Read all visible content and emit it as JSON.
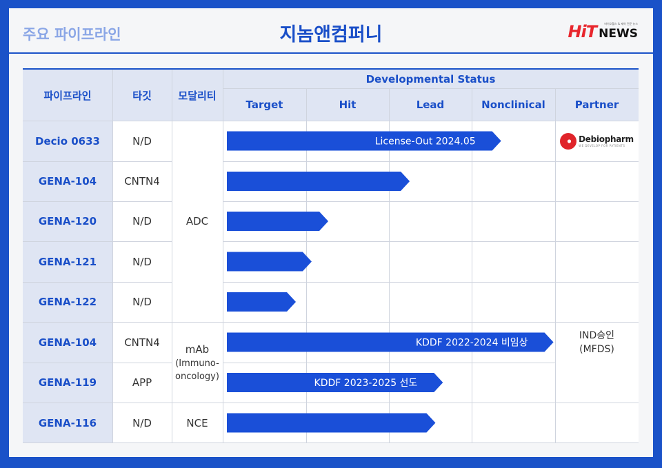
{
  "header": {
    "section_label": "주요 파이프라인",
    "company": "지놈앤컴퍼니",
    "logo_hit": "HiT",
    "logo_news": "NEWS",
    "logo_tagline": "바이오헬스 & 제약 전문 뉴스"
  },
  "table": {
    "col_headers": {
      "pipeline": "파이프라인",
      "target": "타깃",
      "modality": "모달리티"
    },
    "status_header": "Developmental Status",
    "stages": [
      "Target",
      "Hit",
      "Lead",
      "Nonclinical"
    ],
    "partner_header": "Partner",
    "modality_groups": [
      {
        "label": "ADC",
        "sublabel": ""
      },
      {
        "label": "mAb",
        "sublabel": "(Immuno-oncology)"
      },
      {
        "label": "NCE",
        "sublabel": ""
      }
    ],
    "partners": {
      "debiopharm_name": "Debiopharm",
      "debiopharm_tagline": "WE DEVELOP FOR PATIENTS",
      "ind_line1": "IND승인",
      "ind_line2": "(MFDS)"
    }
  },
  "chart_data": {
    "type": "bar",
    "orientation": "horizontal",
    "title": "",
    "x_axis_categories": [
      "Target",
      "Hit",
      "Lead",
      "Nonclinical"
    ],
    "x_range": [
      0,
      4
    ],
    "rows": [
      {
        "pipeline": "Decio 0633",
        "target": "N/D",
        "modality": "ADC",
        "progress": 3.35,
        "label": "License-Out 2024.05",
        "partner": "Debiopharm"
      },
      {
        "pipeline": "GENA-104",
        "target": "CNTN4",
        "modality": "ADC",
        "progress": 2.25,
        "label": "",
        "partner": ""
      },
      {
        "pipeline": "GENA-120",
        "target": "N/D",
        "modality": "ADC",
        "progress": 1.27,
        "label": "",
        "partner": ""
      },
      {
        "pipeline": "GENA-121",
        "target": "N/D",
        "modality": "ADC",
        "progress": 1.07,
        "label": "",
        "partner": ""
      },
      {
        "pipeline": "GENA-122",
        "target": "N/D",
        "modality": "ADC",
        "progress": 0.88,
        "label": "",
        "partner": ""
      },
      {
        "pipeline": "GENA-104",
        "target": "CNTN4",
        "modality": "mAb (Immuno-oncology)",
        "progress": 3.98,
        "label": "KDDF 2022-2024 비임상",
        "partner": "IND승인 (MFDS)"
      },
      {
        "pipeline": "GENA-119",
        "target": "APP",
        "modality": "mAb (Immuno-oncology)",
        "progress": 2.65,
        "label": "KDDF 2023-2025 선도",
        "partner": ""
      },
      {
        "pipeline": "GENA-116",
        "target": "N/D",
        "modality": "NCE",
        "progress": 2.56,
        "label": "",
        "partner": ""
      }
    ],
    "bar_color": "#1a4fd8"
  }
}
